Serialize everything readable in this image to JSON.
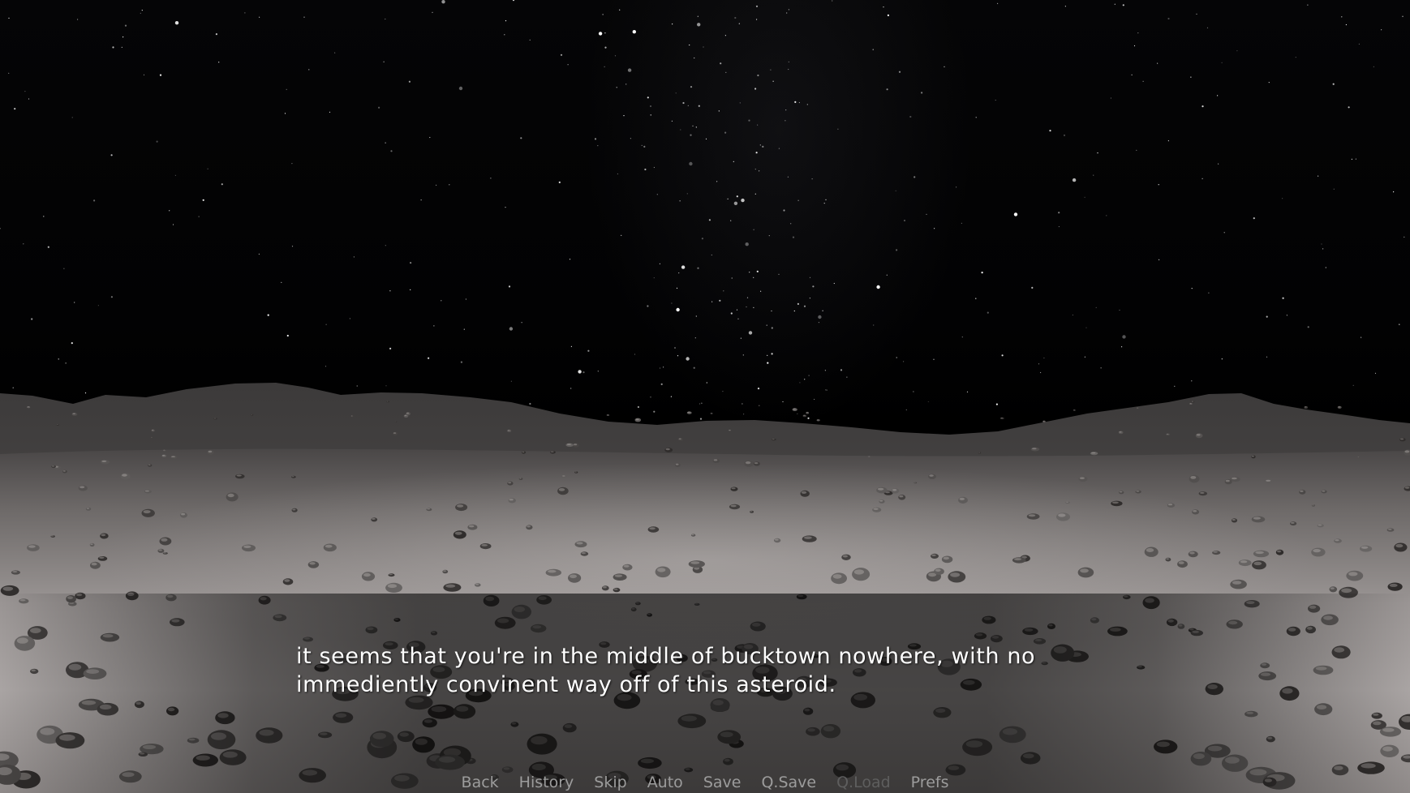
{
  "dialogue": {
    "line1": "it seems that you're in the middle of bucktown nowhere, with no",
    "line2": "immediently convinent way off of this asteroid."
  },
  "quick_menu": {
    "items": [
      {
        "label": "Back",
        "enabled": true
      },
      {
        "label": "History",
        "enabled": true
      },
      {
        "label": "Skip",
        "enabled": true
      },
      {
        "label": "Auto",
        "enabled": true
      },
      {
        "label": "Save",
        "enabled": true
      },
      {
        "label": "Q.Save",
        "enabled": true
      },
      {
        "label": "Q.Load",
        "enabled": false
      },
      {
        "label": "Prefs",
        "enabled": true
      }
    ]
  },
  "colors": {
    "menu_text": "#9c9c9c",
    "menu_text_disabled": "#5e5e5e",
    "dialogue_text": "#ffffff"
  }
}
